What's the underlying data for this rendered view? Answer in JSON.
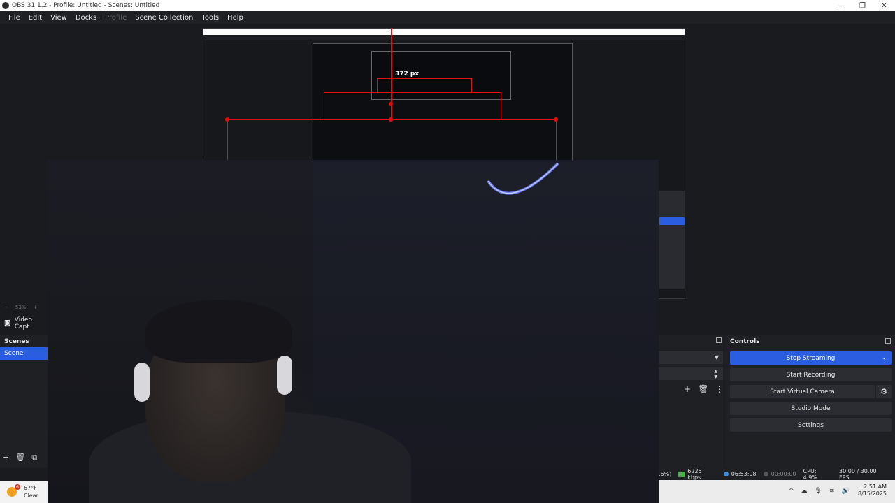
{
  "window": {
    "title": "OBS 31.1.2 - Profile: Untitled - Scenes: Untitled",
    "controls": [
      "—",
      "❐",
      "✕"
    ]
  },
  "menu": [
    "File",
    "Edit",
    "View",
    "Docks",
    "Profile",
    "Scene Collection",
    "Tools",
    "Help"
  ],
  "preview": {
    "measure_label": "372 px",
    "zoom": "53%"
  },
  "sources": {
    "item": "Video Capt"
  },
  "scenes": {
    "title": "Scenes",
    "items": [
      "Scene"
    ]
  },
  "controls": {
    "title": "Controls",
    "stop_streaming": "Stop Streaming",
    "start_recording": "Start Recording",
    "start_virtual_camera": "Start Virtual Camera",
    "studio_mode": "Studio Mode",
    "settings": "Settings"
  },
  "status": {
    "dropped": ".6%)",
    "bitrate": "6225 kbps",
    "stream_time": "06:53:08",
    "rec_time": "00:00:00",
    "cpu": "CPU: 4.9%",
    "fps": "30.00 / 30.00 FPS"
  },
  "weather": {
    "badge": "6",
    "temp": "67°F",
    "condition": "Clear"
  },
  "clock": {
    "time": "2:51 AM",
    "date": "8/15/2025"
  },
  "colors": {
    "accent": "#2b5de0",
    "selection": "#e01010"
  }
}
